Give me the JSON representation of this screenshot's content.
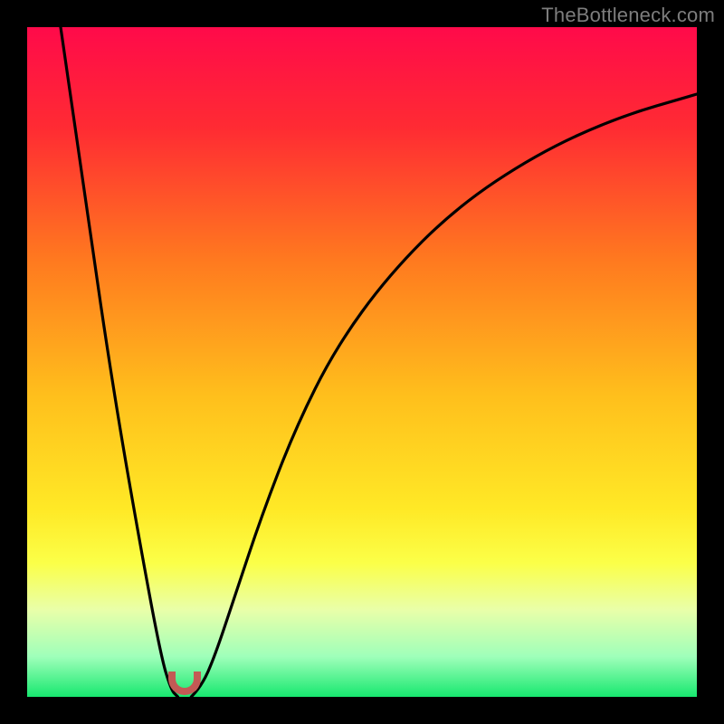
{
  "watermark": "TheBottleneck.com",
  "chart_data": {
    "type": "line",
    "title": "",
    "xlabel": "",
    "ylabel": "",
    "xlim": [
      0,
      100
    ],
    "ylim": [
      0,
      100
    ],
    "gradient_stops": [
      {
        "pos": 0,
        "color": "#ff0a4a"
      },
      {
        "pos": 15,
        "color": "#ff2b33"
      },
      {
        "pos": 35,
        "color": "#ff7a1f"
      },
      {
        "pos": 55,
        "color": "#ffbf1c"
      },
      {
        "pos": 72,
        "color": "#ffe926"
      },
      {
        "pos": 80,
        "color": "#fbff48"
      },
      {
        "pos": 87,
        "color": "#e9ffa9"
      },
      {
        "pos": 94,
        "color": "#9fffba"
      },
      {
        "pos": 100,
        "color": "#17e86f"
      }
    ],
    "series": [
      {
        "name": "left-branch",
        "x": [
          5,
          9,
          13,
          17,
          20,
          21.5,
          22.5
        ],
        "y": [
          100,
          72,
          45,
          22,
          6,
          1,
          0
        ]
      },
      {
        "name": "right-branch",
        "x": [
          24.5,
          26,
          28,
          31,
          35,
          40,
          46,
          54,
          64,
          76,
          88,
          100
        ],
        "y": [
          0,
          1.5,
          6,
          15,
          27,
          40,
          52,
          63,
          73,
          81,
          86.5,
          90
        ]
      }
    ],
    "marker": {
      "x": 23.5,
      "y": 2,
      "shape": "u",
      "color": "#c35a55"
    },
    "annotations": []
  }
}
